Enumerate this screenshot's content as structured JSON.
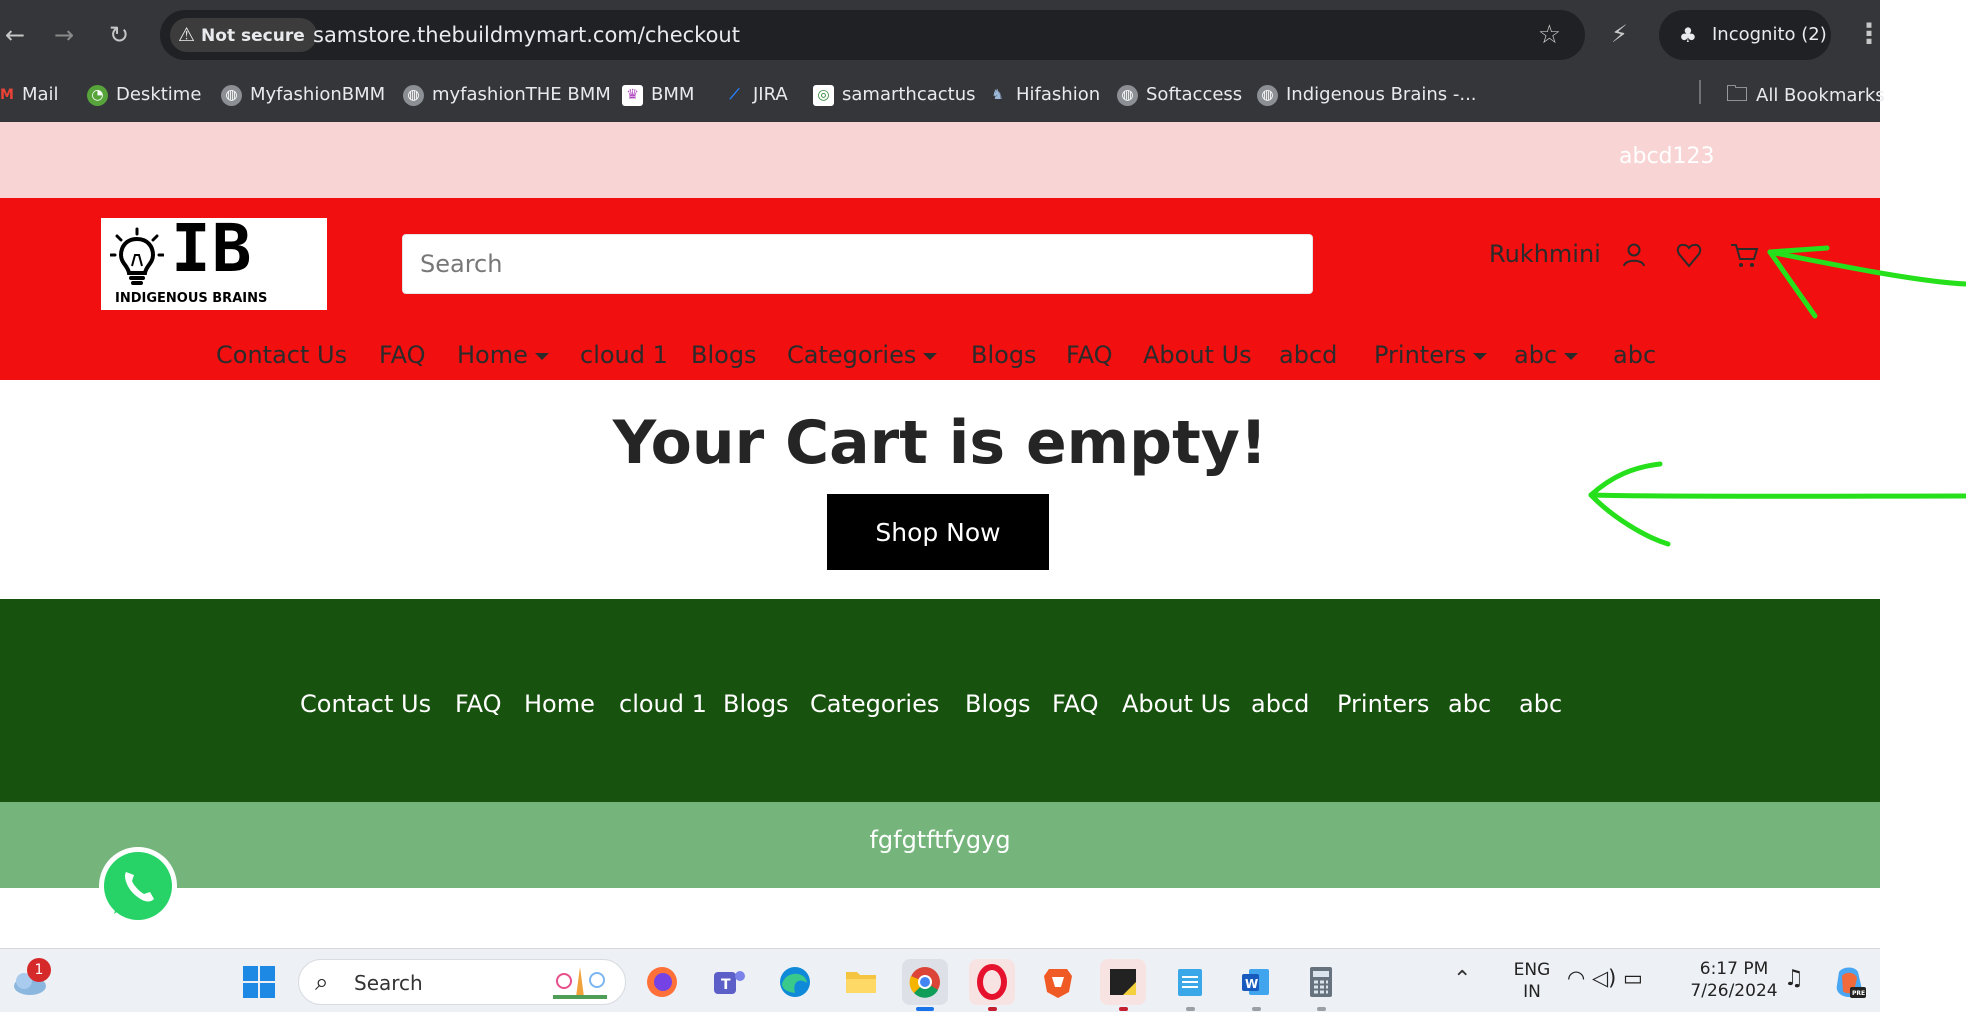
{
  "browser": {
    "security_label": "Not secure",
    "url": "samstore.thebuildmymart.com/checkout",
    "incognito_label": "Incognito (2)",
    "bookmarks": [
      {
        "label": "Mail",
        "icon": "gmail-icon",
        "color": "#ea4335"
      },
      {
        "label": "Desktime",
        "icon": "desktime-icon",
        "color": "#56a43a"
      },
      {
        "label": "MyfashionBMM",
        "icon": "globe-icon",
        "color": "#8c8f94"
      },
      {
        "label": "myfashionTHE BMM",
        "icon": "globe-icon",
        "color": "#8c8f94"
      },
      {
        "label": "BMM",
        "icon": "bmm-icon",
        "color": "#b04ac0"
      },
      {
        "label": "JIRA",
        "icon": "jira-icon",
        "color": "#2684ff"
      },
      {
        "label": "samarthcactus",
        "icon": "cactus-icon",
        "color": "#2f8a33"
      },
      {
        "label": "Hifashion",
        "icon": "hifashion-icon",
        "color": "#5b7a9c"
      },
      {
        "label": "Softaccess",
        "icon": "globe-icon",
        "color": "#8c8f94"
      },
      {
        "label": "Indigenous Brains -...",
        "icon": "globe-icon",
        "color": "#8c8f94"
      }
    ],
    "all_bookmarks_label": "All Bookmarks"
  },
  "site": {
    "topbar_text": "abcd123",
    "logo": {
      "text": "IB",
      "caption": "INDIGENOUS BRAINS"
    },
    "search_placeholder": "Search",
    "username": "Rukhmini",
    "nav": [
      {
        "label": "Contact Us",
        "dropdown": false
      },
      {
        "label": "FAQ",
        "dropdown": false
      },
      {
        "label": "Home",
        "dropdown": true
      },
      {
        "label": "cloud 1",
        "dropdown": false
      },
      {
        "label": "Blogs",
        "dropdown": false
      },
      {
        "label": "Categories",
        "dropdown": true
      },
      {
        "label": "Blogs",
        "dropdown": false
      },
      {
        "label": "FAQ",
        "dropdown": false
      },
      {
        "label": "About Us",
        "dropdown": false
      },
      {
        "label": "abcd",
        "dropdown": false
      },
      {
        "label": "Printers",
        "dropdown": true
      },
      {
        "label": "abc",
        "dropdown": true
      },
      {
        "label": "abc",
        "dropdown": false
      }
    ],
    "cart": {
      "message": "Your Cart is empty!",
      "button_label": "Shop Now"
    },
    "footer": {
      "links": [
        "Contact Us",
        "FAQ",
        "Home",
        "cloud 1",
        "Blogs",
        "Categories",
        "Blogs",
        "FAQ",
        "About Us",
        "abcd",
        "Printers",
        "abc",
        "abc"
      ],
      "bottom_text": "fgfgtftfygyg"
    },
    "colors": {
      "topbar": "#f8d5d4",
      "header": "#f10f0f",
      "footer_main": "#18520f",
      "footer_bottom": "#75b57b",
      "annotation": "#25e01a"
    }
  },
  "taskbar": {
    "weather_badge": "1",
    "search_label": "Search",
    "language_line1": "ENG",
    "language_line2": "IN",
    "time": "6:17 PM",
    "date": "7/26/2024"
  }
}
